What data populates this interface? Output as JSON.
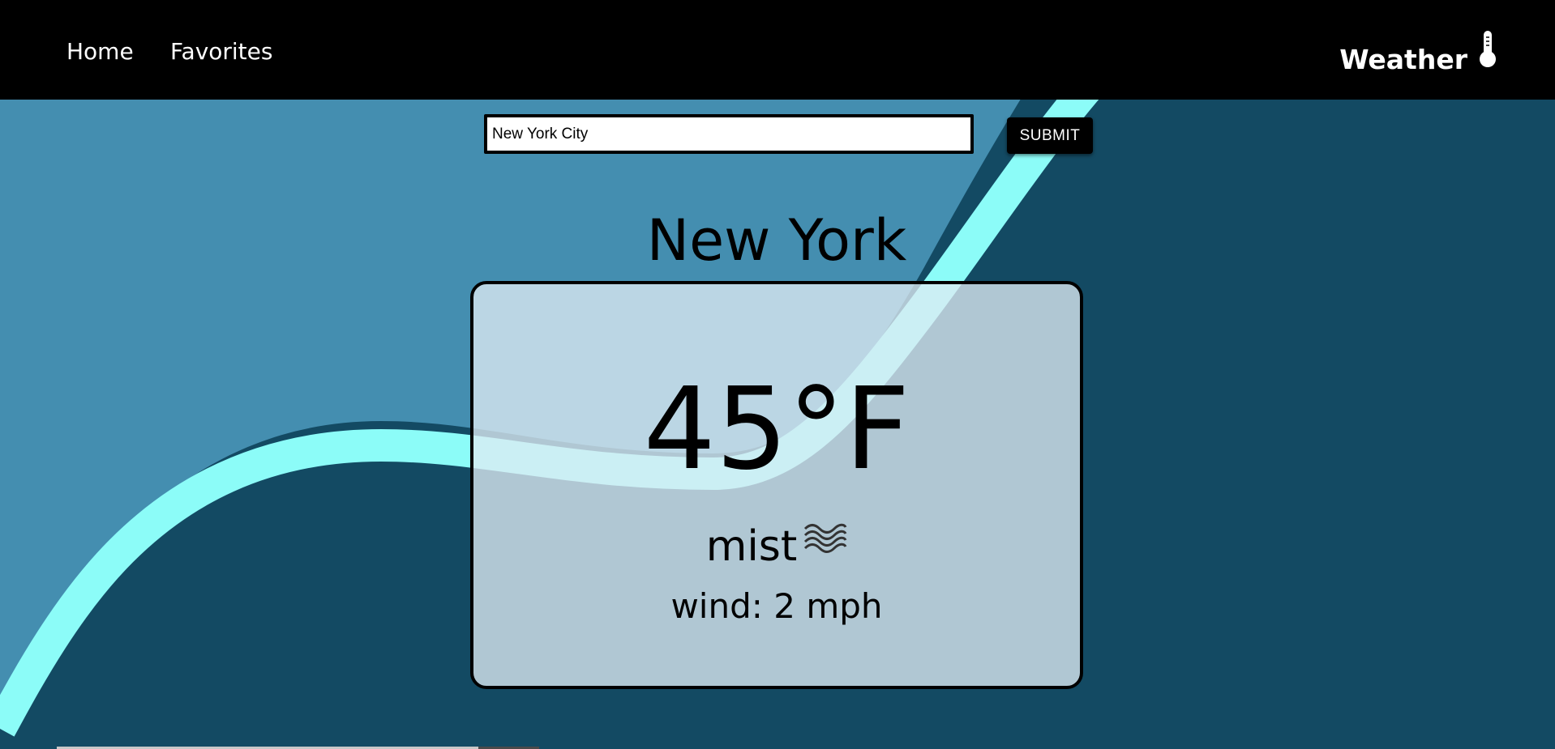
{
  "nav": {
    "home_label": "Home",
    "favorites_label": "Favorites",
    "brand_title": "Weather",
    "brand_icon": "thermometer-icon"
  },
  "search": {
    "value": "New York City",
    "submit_label": "SUBMIT"
  },
  "weather": {
    "city": "New York",
    "temperature": "45°F",
    "condition": "mist",
    "condition_icon": "mist-icon",
    "wind": "wind: 2 mph"
  },
  "colors": {
    "navbar": "#000000",
    "background_light": "#448eb0",
    "background_dark": "#134a63",
    "wave_stripe": "#8cfcf8",
    "card_fill": "#dcebf2"
  }
}
